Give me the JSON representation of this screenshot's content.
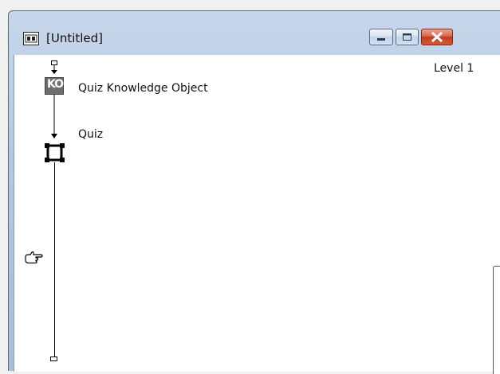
{
  "window": {
    "title": "[Untitled]",
    "controls": {
      "minimize": "minimize-icon",
      "maximize": "maximize-icon",
      "close": "close-icon"
    }
  },
  "flowchart": {
    "level_label": "Level 1",
    "icons": [
      {
        "label": "Quiz Knowledge Object",
        "badge": "KO",
        "icon": "knowledge-object-icon"
      },
      {
        "label": "Quiz",
        "icon": "framework-icon"
      }
    ],
    "cursor_icon": "pointing-hand-icon"
  },
  "colors": {
    "titlebar": "#b5c8e1",
    "close_button": "#c33c1c",
    "canvas": "#ffffff",
    "ko_badge": "#6e6e6e"
  }
}
